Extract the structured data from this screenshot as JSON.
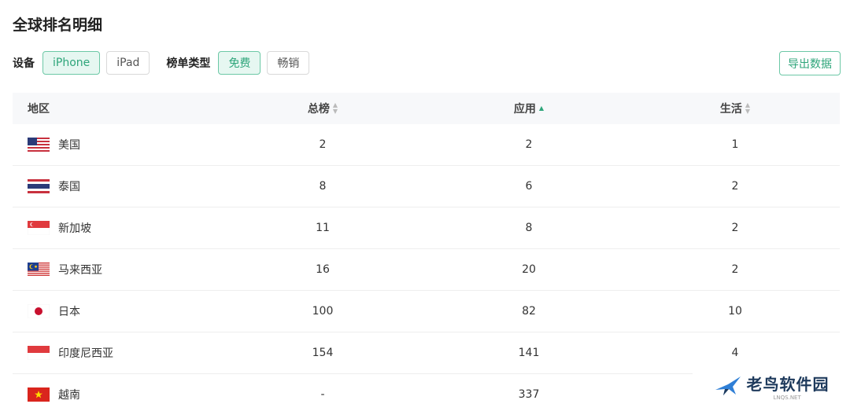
{
  "page": {
    "title": "全球排名明细"
  },
  "filters": {
    "device_label": "设备",
    "devices": [
      "iPhone",
      "iPad"
    ],
    "chart_type_label": "榜单类型",
    "chart_types": [
      "免费",
      "畅销"
    ]
  },
  "actions": {
    "export_label": "导出数据"
  },
  "table": {
    "headers": [
      "地区",
      "总榜",
      "应用",
      "生活"
    ],
    "rows": [
      {
        "region": "美国",
        "flag": "us-flag-icon",
        "total": "2",
        "app": "2",
        "life": "1"
      },
      {
        "region": "泰国",
        "flag": "th-flag-icon",
        "total": "8",
        "app": "6",
        "life": "2"
      },
      {
        "region": "新加坡",
        "flag": "sg-flag-icon",
        "total": "11",
        "app": "8",
        "life": "2"
      },
      {
        "region": "马来西亚",
        "flag": "my-flag-icon",
        "total": "16",
        "app": "20",
        "life": "2"
      },
      {
        "region": "日本",
        "flag": "jp-flag-icon",
        "total": "100",
        "app": "82",
        "life": "10"
      },
      {
        "region": "印度尼西亚",
        "flag": "id-flag-icon",
        "total": "154",
        "app": "141",
        "life": "4"
      },
      {
        "region": "越南",
        "flag": "vn-flag-icon",
        "total": "-",
        "app": "337",
        "life": ""
      }
    ]
  },
  "watermark": {
    "text": "老鸟软件园",
    "sub": "LNQS.NET"
  },
  "colors": {
    "accent": "#2ea57a",
    "accent_bg": "#e6f7f1",
    "header_bg": "#f7f8fa"
  }
}
